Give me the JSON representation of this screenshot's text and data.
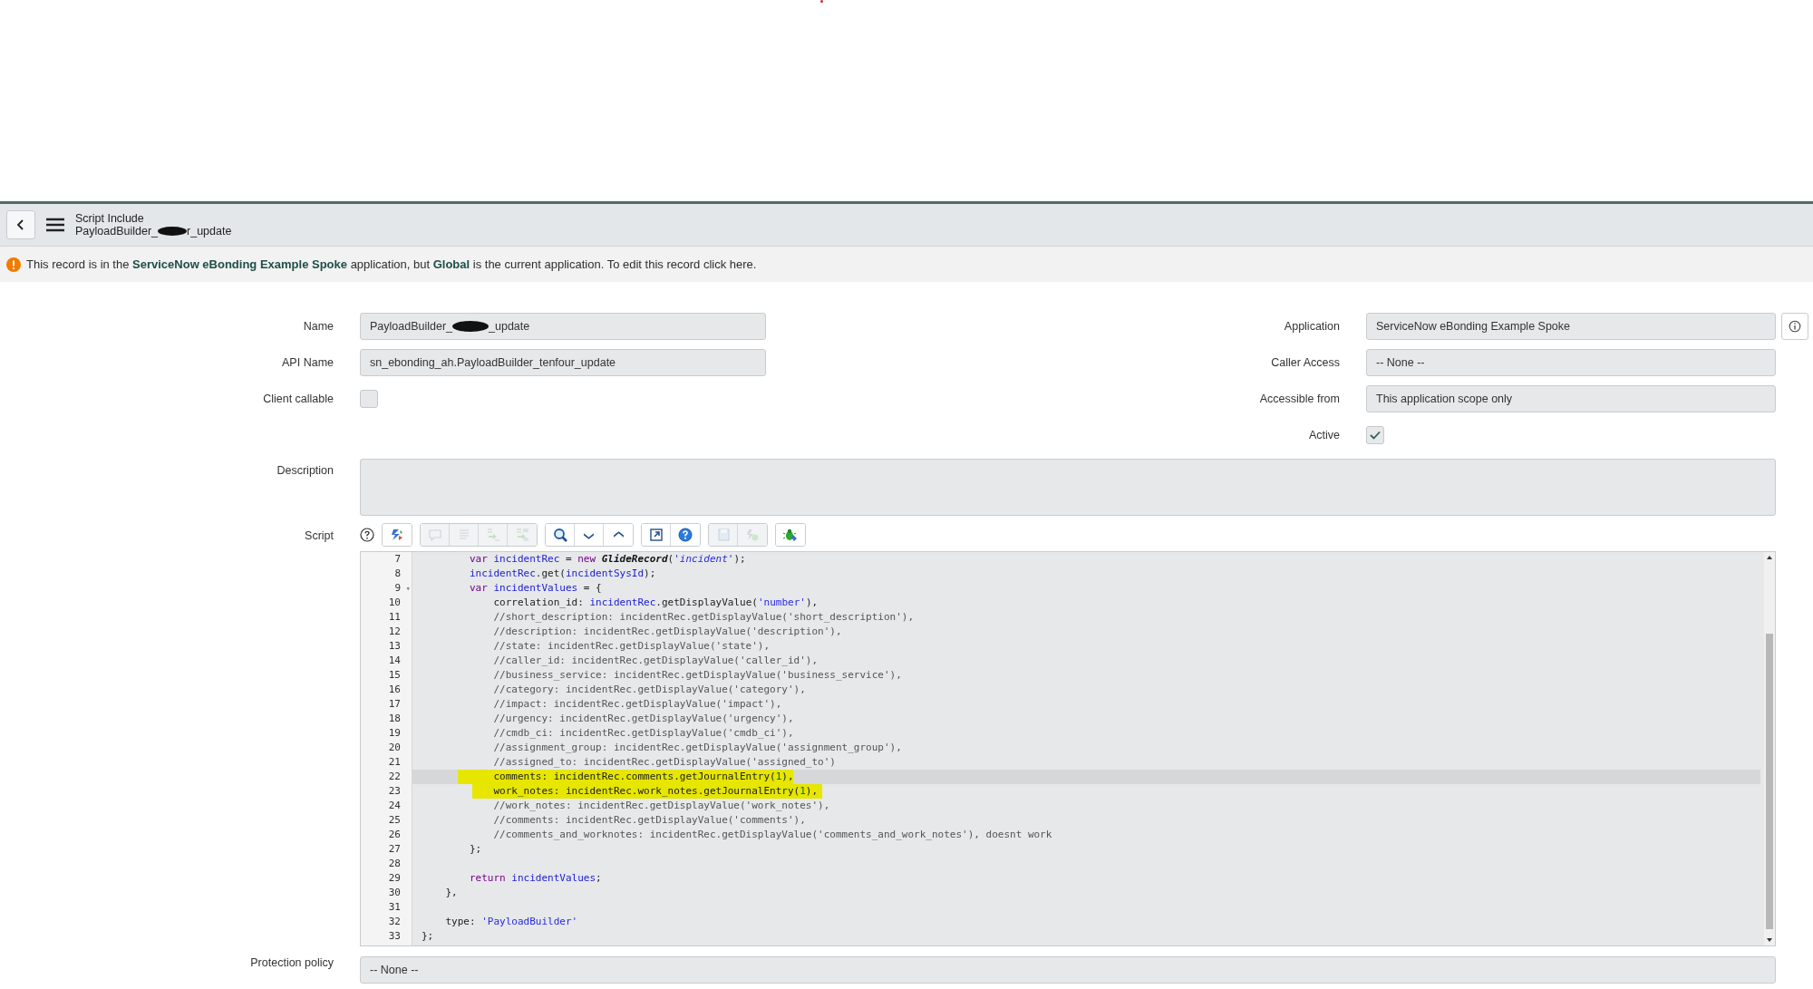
{
  "header": {
    "title": "Script Include",
    "record_prefix": "PayloadBuilder_",
    "record_suffix": "r_update"
  },
  "notice": {
    "text": "This record is in the **ServiceNow eBonding Example Spoke** application, but **Global** is the current application. To edit this record click here."
  },
  "fields_left": [
    {
      "label": "Name",
      "kind": "redacted",
      "prefix": "PayloadBuilder_",
      "suffix": "_update"
    },
    {
      "label": "API Name",
      "kind": "text",
      "value": "sn_ebonding_ah.PayloadBuilder_tenfour_update"
    },
    {
      "label": "Client callable",
      "kind": "checkbox",
      "checked": false
    }
  ],
  "fields_right": [
    {
      "label": "Application",
      "kind": "text",
      "value": "ServiceNow eBonding Example Spoke",
      "info": true
    },
    {
      "label": "Caller Access",
      "kind": "text",
      "value": "-- None --",
      "info": false
    },
    {
      "label": "Accessible from",
      "kind": "text",
      "value": "This application scope only",
      "info": false
    },
    {
      "label": "Active",
      "kind": "checkbox",
      "checked": true
    }
  ],
  "description": {
    "label": "Description"
  },
  "script": {
    "label": "Script",
    "toolbar": [
      [
        {
          "kind": "format",
          "disabled": false
        }
      ],
      [
        {
          "kind": "comment",
          "disabled": true
        },
        {
          "kind": "indent",
          "disabled": true
        },
        {
          "kind": "replace",
          "disabled": true
        },
        {
          "kind": "replace-all",
          "disabled": true
        }
      ],
      [
        {
          "kind": "search",
          "disabled": false
        },
        {
          "kind": "next",
          "disabled": false
        },
        {
          "kind": "previous",
          "disabled": false
        }
      ],
      [
        {
          "kind": "fullscreen",
          "disabled": false
        },
        {
          "kind": "help",
          "disabled": false
        }
      ],
      [
        {
          "kind": "save",
          "disabled": true
        },
        {
          "kind": "validate",
          "disabled": true
        }
      ],
      [
        {
          "kind": "debug",
          "disabled": false
        }
      ]
    ],
    "lines": [
      {
        "number": "7",
        "tokens": [
          {
            "kind": "keyword",
            "text": "        var "
          },
          {
            "kind": "variable",
            "text": "incidentRec"
          },
          {
            "kind": "plain",
            "text": " = "
          },
          {
            "kind": "keyword",
            "text": "new "
          },
          {
            "kind": "class",
            "text": "GlideRecord"
          },
          {
            "kind": "plain",
            "text": "("
          },
          {
            "kind": "string-italic",
            "text": "'incident'"
          },
          {
            "kind": "plain",
            "text": ");"
          }
        ]
      },
      {
        "number": "8",
        "tokens": [
          {
            "kind": "variable",
            "text": "        incidentRec"
          },
          {
            "kind": "plain",
            "text": ".get("
          },
          {
            "kind": "variable",
            "text": "incidentSysId"
          },
          {
            "kind": "plain",
            "text": ");"
          }
        ]
      },
      {
        "number": "9",
        "fold": "▾",
        "tokens": [
          {
            "kind": "keyword",
            "text": "        var "
          },
          {
            "kind": "variable",
            "text": "incidentValues"
          },
          {
            "kind": "plain",
            "text": " = {"
          }
        ]
      },
      {
        "number": "10",
        "tokens": [
          {
            "kind": "plain",
            "text": "            correlation_id: "
          },
          {
            "kind": "variable",
            "text": "incidentRec"
          },
          {
            "kind": "plain",
            "text": ".getDisplayValue("
          },
          {
            "kind": "string",
            "text": "'number'"
          },
          {
            "kind": "plain",
            "text": "),"
          }
        ]
      },
      {
        "number": "11",
        "tokens": [
          {
            "kind": "comment",
            "text": "            //short_description: incidentRec.getDisplayValue('short_description'),"
          }
        ]
      },
      {
        "number": "12",
        "tokens": [
          {
            "kind": "comment",
            "text": "            //description: incidentRec.getDisplayValue('description'),"
          }
        ]
      },
      {
        "number": "13",
        "tokens": [
          {
            "kind": "comment",
            "text": "            //state: incidentRec.getDisplayValue('state'),"
          }
        ]
      },
      {
        "number": "14",
        "tokens": [
          {
            "kind": "comment",
            "text": "            //caller_id: incidentRec.getDisplayValue('caller_id'),"
          }
        ]
      },
      {
        "number": "15",
        "tokens": [
          {
            "kind": "comment",
            "text": "            //business_service: incidentRec.getDisplayValue('business_service'),"
          }
        ]
      },
      {
        "number": "16",
        "tokens": [
          {
            "kind": "comment",
            "text": "            //category: incidentRec.getDisplayValue('category'),"
          }
        ]
      },
      {
        "number": "17",
        "tokens": [
          {
            "kind": "comment",
            "text": "            //impact: incidentRec.getDisplayValue('impact'),"
          }
        ]
      },
      {
        "number": "18",
        "tokens": [
          {
            "kind": "comment",
            "text": "            //urgency: incidentRec.getDisplayValue('urgency'),"
          }
        ]
      },
      {
        "number": "19",
        "tokens": [
          {
            "kind": "comment",
            "text": "            //cmdb_ci: incidentRec.getDisplayValue('cmdb_ci'),"
          }
        ]
      },
      {
        "number": "20",
        "tokens": [
          {
            "kind": "comment",
            "text": "            //assignment_group: incidentRec.getDisplayValue('assignment_group'),"
          }
        ]
      },
      {
        "number": "21",
        "tokens": [
          {
            "kind": "comment",
            "text": "            //assigned_to: incidentRec.getDisplayValue('assigned_to')"
          }
        ]
      },
      {
        "number": "22",
        "active": true,
        "marked": true,
        "tokens": [
          {
            "kind": "plain",
            "text": "            comments: incidentRec.comments.getJournalEntry("
          },
          {
            "kind": "number",
            "text": "1"
          },
          {
            "kind": "plain",
            "text": "),"
          }
        ]
      },
      {
        "number": "23",
        "active": false,
        "marked": true,
        "tokens": [
          {
            "kind": "plain",
            "text": "            work_notes: incidentRec.work_notes.getJournalEntry("
          },
          {
            "kind": "number",
            "text": "1"
          },
          {
            "kind": "plain",
            "text": "),"
          }
        ]
      },
      {
        "number": "24",
        "tokens": [
          {
            "kind": "comment",
            "text": "            //work_notes: incidentRec.getDisplayValue('work_notes'),"
          }
        ]
      },
      {
        "number": "25",
        "tokens": [
          {
            "kind": "comment",
            "text": "            //comments: incidentRec.getDisplayValue('comments'),"
          }
        ]
      },
      {
        "number": "26",
        "tokens": [
          {
            "kind": "comment",
            "text": "            //comments_and_worknotes: incidentRec.getDisplayValue('comments_and_work_notes'), doesnt work"
          }
        ]
      },
      {
        "number": "27",
        "tokens": [
          {
            "kind": "plain",
            "text": "        };"
          }
        ]
      },
      {
        "number": "28"
      },
      {
        "number": "29",
        "tokens": [
          {
            "kind": "keyword",
            "text": "        return "
          },
          {
            "kind": "variable",
            "text": "incidentValues"
          },
          {
            "kind": "plain",
            "text": ";"
          }
        ]
      },
      {
        "number": "30",
        "tokens": [
          {
            "kind": "plain",
            "text": "    },"
          }
        ]
      },
      {
        "number": "31"
      },
      {
        "number": "32",
        "tokens": [
          {
            "kind": "plain",
            "text": "    type: "
          },
          {
            "kind": "string",
            "text": "'PayloadBuilder'"
          }
        ]
      },
      {
        "number": "33",
        "tokens": [
          {
            "kind": "plain",
            "text": "};"
          }
        ]
      }
    ]
  },
  "protection": {
    "label": "Protection policy",
    "value": "-- None --"
  }
}
